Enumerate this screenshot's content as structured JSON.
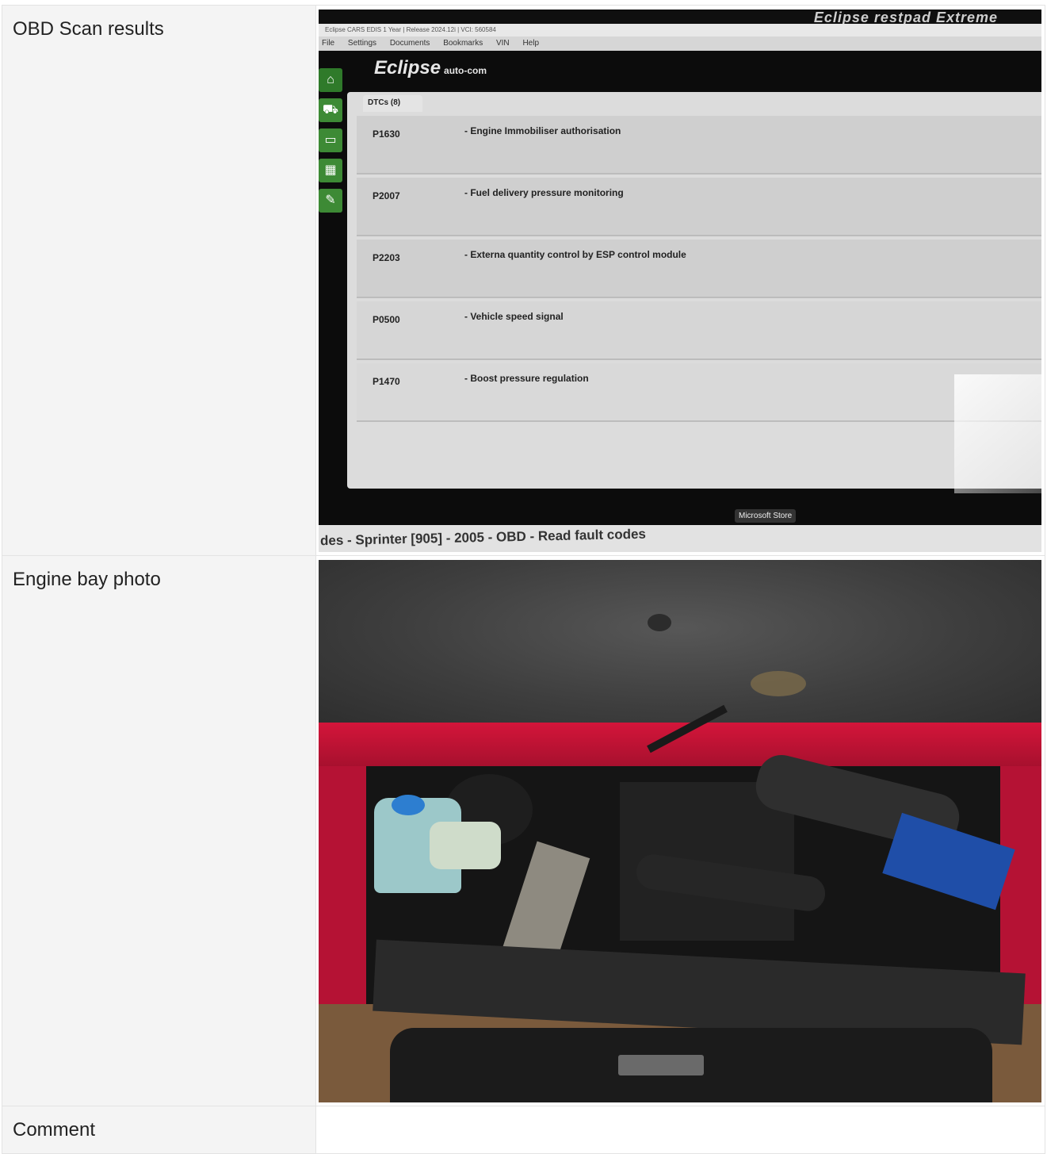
{
  "rows": [
    {
      "label": "OBD Scan results"
    },
    {
      "label": "Engine bay photo"
    },
    {
      "label": "Comment"
    }
  ],
  "screen": {
    "brand": "Eclipse restpad Extreme",
    "titlebar": "Eclipse CARS EDIS 1 Year | Release 2024.12i | VCI: 560584",
    "menu": [
      "File",
      "Settings",
      "Documents",
      "Bookmarks",
      "VIN",
      "Help"
    ],
    "logo": "Eclipse",
    "logo_suffix": "auto-com",
    "tab_label": "DTCs (8)",
    "dtcs": [
      {
        "code": "P1630",
        "description": "- Engine Immobiliser authorisation"
      },
      {
        "code": "P2007",
        "description": "- Fuel delivery pressure monitoring"
      },
      {
        "code": "P2203",
        "description": "- Externa quantity control by ESP control module"
      },
      {
        "code": "P0500",
        "description": "- Vehicle speed signal"
      },
      {
        "code": "P1470",
        "description": "- Boost pressure regulation"
      }
    ],
    "footer": "des - Sprinter [905] - 2005 - OBD - Read fault codes",
    "tooltip": "Microsoft Store"
  },
  "colors": {
    "label_bg": "#f4f4f4",
    "border": "#e3e3e3",
    "sidebar_green": "#3d8a35"
  },
  "icons": {
    "sidebar": [
      "home-icon",
      "car-icon",
      "battery-icon",
      "chart-icon",
      "wrench-icon"
    ]
  }
}
